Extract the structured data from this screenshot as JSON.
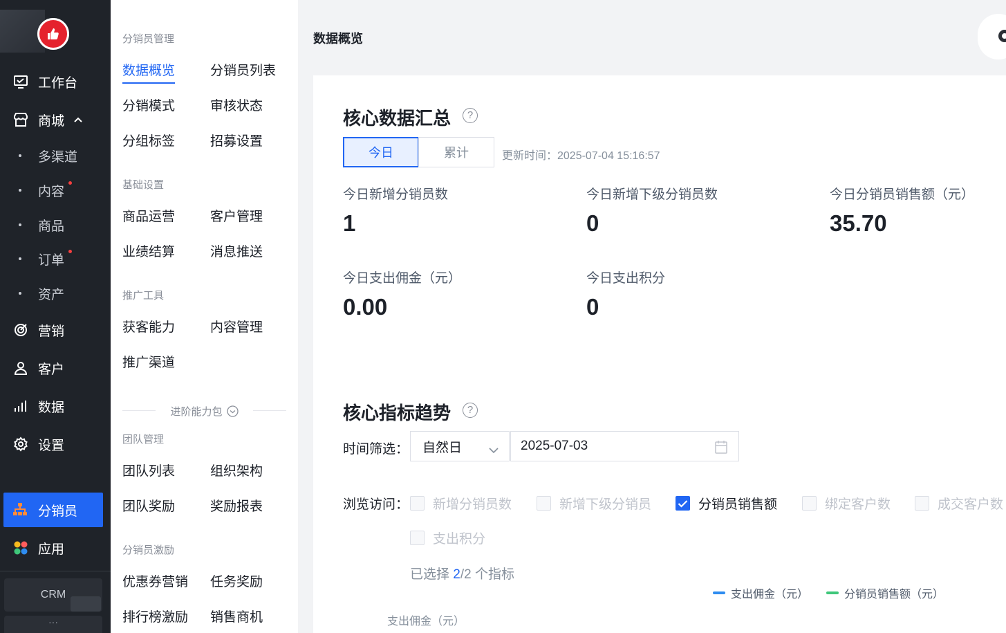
{
  "nav": {
    "items": [
      {
        "label": "工作台",
        "icon": "workbench-icon"
      },
      {
        "label": "商城",
        "icon": "store-icon"
      },
      {
        "label": "营销",
        "icon": "marketing-icon"
      },
      {
        "label": "客户",
        "icon": "customer-icon"
      },
      {
        "label": "数据",
        "icon": "data-chart-icon"
      },
      {
        "label": "设置",
        "icon": "gear-icon"
      }
    ],
    "store_sub": [
      "多渠道",
      "内容",
      "商品",
      "订单",
      "资产"
    ],
    "active": "分销员",
    "apps": "应用",
    "crm": "CRM",
    "more": "···"
  },
  "menu": {
    "groups": [
      {
        "title": "分销员管理",
        "items": [
          "数据概览",
          "分销员列表",
          "分销模式",
          "审核状态",
          "分组标签",
          "招募设置"
        ]
      },
      {
        "title": "基础设置",
        "items": [
          "商品运营",
          "客户管理",
          "业绩结算",
          "消息推送"
        ]
      },
      {
        "title": "推广工具",
        "items": [
          "获客能力",
          "内容管理",
          "推广渠道"
        ]
      },
      {
        "title": "团队管理",
        "items": [
          "团队列表",
          "组织架构",
          "团队奖励",
          "奖励报表"
        ]
      },
      {
        "title": "分销员激励",
        "items": [
          "优惠券营销",
          "任务奖励",
          "排行榜激励",
          "销售商机"
        ]
      }
    ],
    "advanced": "进阶能力包"
  },
  "page": {
    "title": "数据概览"
  },
  "summary": {
    "title": "核心数据汇总",
    "tabs": [
      "今日",
      "累计"
    ],
    "update_time": "更新时间：2025-07-04 15:16:57",
    "stats": [
      {
        "label": "今日新增分销员数",
        "value": "1"
      },
      {
        "label": "今日新增下级分销员数",
        "value": "0"
      },
      {
        "label": "今日分销员销售额（元）",
        "value": "35.70"
      },
      {
        "label": "今日支出佣金（元）",
        "value": "0.00"
      },
      {
        "label": "今日支出积分",
        "value": "0"
      }
    ]
  },
  "trend": {
    "title": "核心指标趋势",
    "time_filter_label": "时间筛选：",
    "period": "自然日",
    "date": "2025-07-03",
    "browse_label": "浏览访问：",
    "metrics": [
      {
        "label": "新增分销员数",
        "checked": false
      },
      {
        "label": "新增下级分销员",
        "checked": false
      },
      {
        "label": "分销员销售额",
        "checked": true
      },
      {
        "label": "绑定客户数",
        "checked": false
      },
      {
        "label": "成交客户数",
        "checked": false
      },
      {
        "label": "支出积分",
        "checked": false
      }
    ],
    "selected_prefix": "已选择 ",
    "selected_count": "2",
    "selected_suffix": "/2 个指标",
    "legend": [
      {
        "label": "支出佣金（元）",
        "color": "#2e8cf0"
      },
      {
        "label": "分销员销售额（元）",
        "color": "#3fc77a"
      }
    ],
    "y_axis_label": "支出佣金（元）"
  },
  "colors": {
    "accent": "#2166f3",
    "nav_bg": "#1f2329",
    "badge": "#f53f3f"
  }
}
